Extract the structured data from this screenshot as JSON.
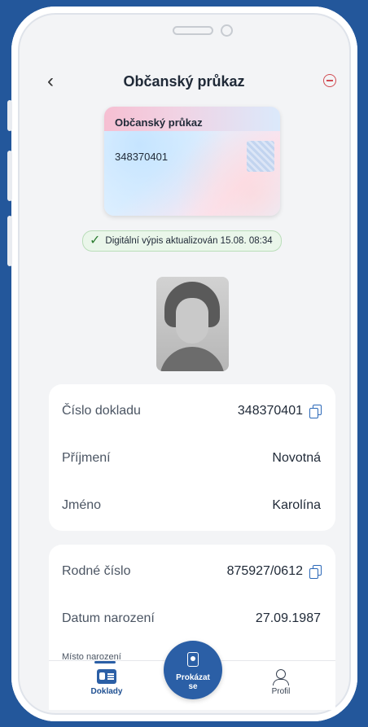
{
  "header": {
    "back_icon": "chevron-left-icon",
    "title": "Občanský průkaz",
    "remove_icon": "minus-circle-icon"
  },
  "card": {
    "name": "Občanský průkaz",
    "number": "348370401"
  },
  "status": {
    "text": "Digitální výpis aktualizován 15.08. 08:34",
    "icon": "check-icon",
    "color": "#2e7d32"
  },
  "section1": [
    {
      "label": "Číslo dokladu",
      "value": "348370401",
      "copy": true
    },
    {
      "label": "Příjmení",
      "value": "Novotná",
      "copy": false
    },
    {
      "label": "Jméno",
      "value": "Karolína",
      "copy": false
    }
  ],
  "section2": [
    {
      "label": "Rodné číslo",
      "value": "875927/0612",
      "copy": true
    },
    {
      "label": "Datum narození",
      "value": "27.09.1987",
      "copy": false
    }
  ],
  "section2_partial_label": "Místo narození",
  "tabbar": {
    "docs_label": "Doklady",
    "show_label_1": "Prokázat",
    "show_label_2": "se",
    "profile_label": "Profil"
  },
  "colors": {
    "accent": "#2b5fa6",
    "background": "#23579b",
    "danger": "#d14b52"
  }
}
